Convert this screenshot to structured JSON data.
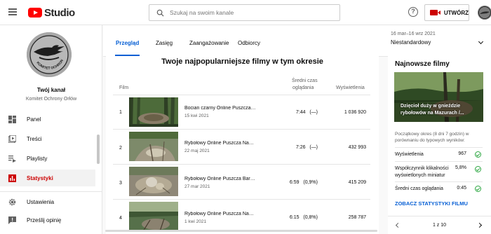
{
  "header": {
    "logo_text": "Studio",
    "search_placeholder": "Szukaj na swoim kanale",
    "help_label": "?",
    "create_label": "UTWÓRZ"
  },
  "sidebar": {
    "channel_title": "Twój kanał",
    "channel_name": "Komitet Ochrony Orłów",
    "avatar_text": "KOMITET OCHRONY ORŁÓW",
    "items": [
      {
        "label": "Panel",
        "icon": "dashboard-icon"
      },
      {
        "label": "Treści",
        "icon": "content-icon"
      },
      {
        "label": "Playlisty",
        "icon": "playlist-icon"
      },
      {
        "label": "Statystyki",
        "icon": "analytics-icon",
        "active": true
      },
      {
        "label": "Ustawienia",
        "icon": "gear-icon"
      },
      {
        "label": "Prześlij opinię",
        "icon": "feedback-icon"
      }
    ]
  },
  "tabs": [
    "Przegląd",
    "Zasięg",
    "Zaangażowanie",
    "Odbiorcy"
  ],
  "date": {
    "range": "16 mar–16 wrz 2021",
    "value": "Niestandardowy"
  },
  "top_videos": {
    "title": "Twoje najpopularniejsze filmy w tym okresie",
    "col_film": "Film",
    "col_time_1": "Średni czas",
    "col_time_2": "oglądania",
    "col_views": "Wyświetlenia",
    "rows": [
      {
        "n": "1",
        "title": "Bocian czarny Online Puszcza Notecka",
        "date": "15 kwi 2021",
        "time": "7:44",
        "pct": "(—)",
        "views": "1 036 920"
      },
      {
        "n": "2",
        "title": "Rybołowy Online Puszcza Napiwodzko",
        "date": "22 maj 2021",
        "time": "7:26",
        "pct": "(—)",
        "views": "432 993"
      },
      {
        "n": "3",
        "title": "Rybołowy Online Puszcza Barlinecka",
        "date": "27 mar 2021",
        "time": "6:59",
        "pct": "(0,9%)",
        "views": "415 209"
      },
      {
        "n": "4",
        "title": "Rybołowy Online Puszcza Napiwodzko",
        "date": "1 kwi 2021",
        "time": "6:15",
        "pct": "(0,8%)",
        "views": "258 787"
      }
    ]
  },
  "latest": {
    "title": "Najnowsze filmy",
    "thumb_line1": "Dzięcioł duży w gnieździe",
    "thumb_line2": "rybołowów na Mazurach /...",
    "note": "Początkowy okres (8 dni 7 godzin) w porównaniu do typowych wyników:",
    "stat1_label": "Wyświetlenia",
    "stat1_value": "967",
    "stat2_label_1": "Współczynnik klikalności",
    "stat2_label_2": "wyświetlonych miniatur",
    "stat2_value": "5,8%",
    "stat3_label": "Średni czas oglądania",
    "stat3_value": "0:45",
    "link": "ZOBACZ STATYSTYKI FILMU",
    "pager": "1 z 10"
  },
  "colors": {
    "accent_blue": "#065fd4",
    "accent_red": "#cc0000",
    "ok_green": "#2ba640"
  }
}
